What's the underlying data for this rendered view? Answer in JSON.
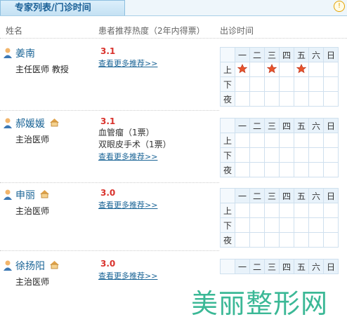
{
  "tab": {
    "label": "专家列表/门诊时间"
  },
  "header": {
    "name_col": "姓名",
    "hot_col": "患者推荐热度（2年内得票）",
    "time_col": "出诊时间"
  },
  "weekdays": [
    "一",
    "二",
    "三",
    "四",
    "五",
    "六",
    "日"
  ],
  "periods": [
    "上",
    "下",
    "夜"
  ],
  "doctors": [
    {
      "name": "姜南",
      "title": "主任医师 教授",
      "score": "3.1",
      "recs": [],
      "more": "查看更多推荐>>",
      "schedule": {
        "上": [
          "一",
          "三",
          "五"
        ]
      }
    },
    {
      "name": "郝媛媛",
      "title": "主治医师",
      "score": "3.1",
      "recs": [
        "血管瘤（1票）",
        "双眼皮手术（1票）"
      ],
      "more": "查看更多推荐>>",
      "schedule": {}
    },
    {
      "name": "申丽",
      "title": "主治医师",
      "score": "3.0",
      "recs": [],
      "more": "查看更多推荐>>",
      "schedule": {}
    },
    {
      "name": "徐扬阳",
      "title": "主治医师",
      "score": "3.0",
      "recs": [],
      "more": "查看更多推荐>>",
      "schedule": {}
    }
  ],
  "watermark": "美丽整形网"
}
